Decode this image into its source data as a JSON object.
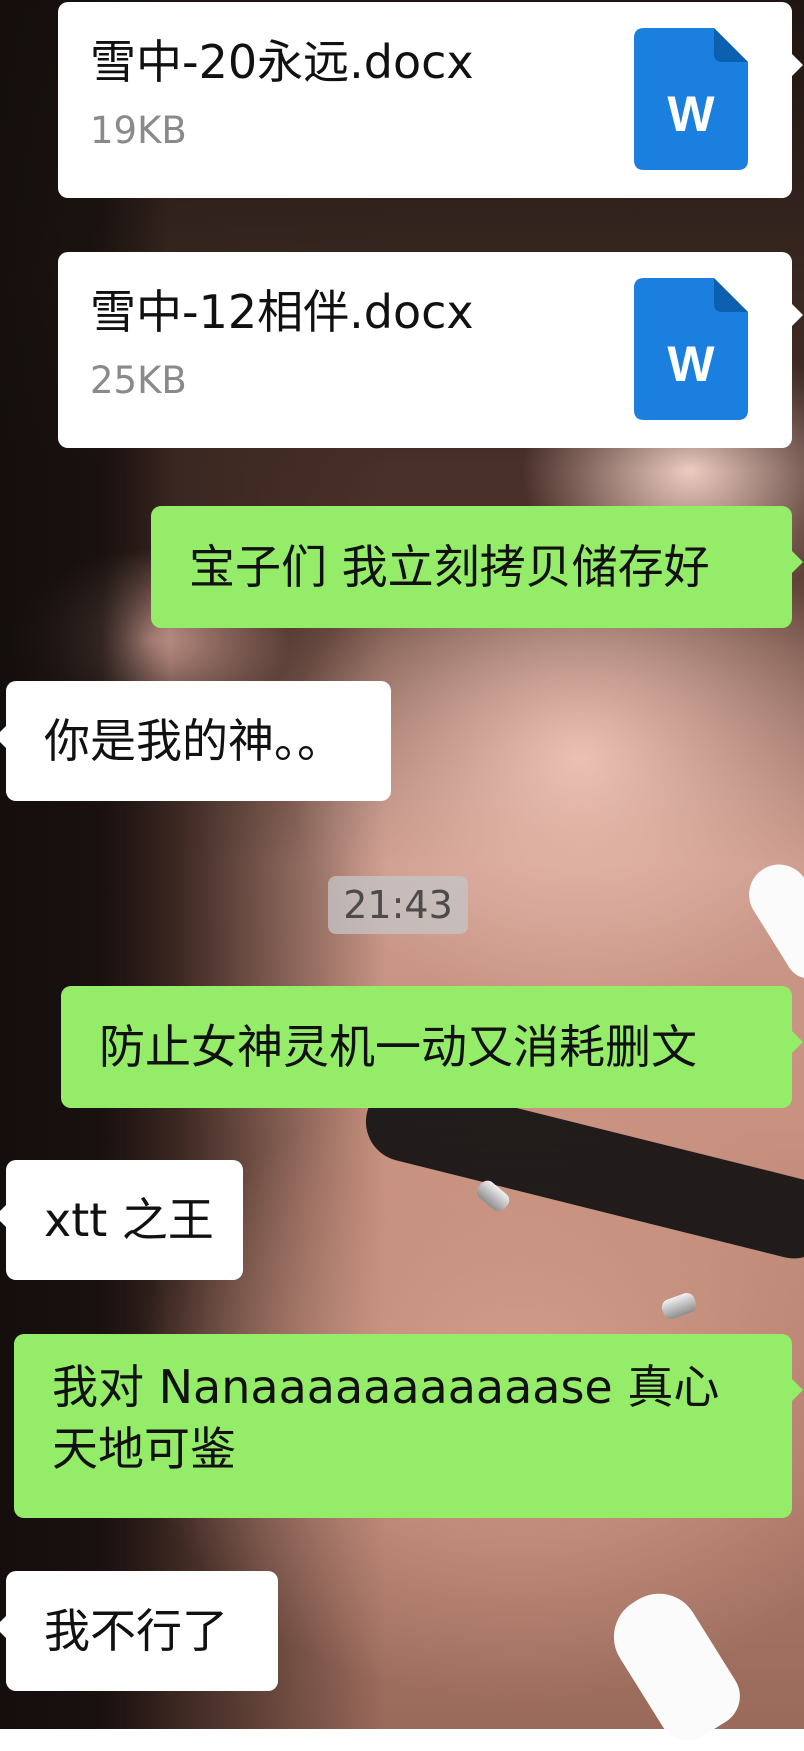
{
  "colors": {
    "sent_bubble": "#95ec69",
    "received_bubble": "#ffffff",
    "word_icon": "#1b7fe0",
    "timestamp_bg": "#c4c4c4"
  },
  "files": [
    {
      "name": "雪中-20永远.docx",
      "size": "19KB",
      "icon": "word-doc-icon",
      "icon_letter": "W"
    },
    {
      "name": "雪中-12相伴.docx",
      "size": "25KB",
      "icon": "word-doc-icon",
      "icon_letter": "W"
    }
  ],
  "messages": [
    {
      "side": "sent",
      "text": "宝子们 我立刻拷贝储存好"
    },
    {
      "side": "received",
      "text": "你是我的神。。"
    },
    {
      "side": "sent",
      "text": "防止女神灵机一动又消耗删文"
    },
    {
      "side": "received",
      "text": "xtt 之王"
    },
    {
      "side": "sent",
      "text": "我对 Nanaaaaaaaaaaase 真心天地可鉴"
    },
    {
      "side": "received",
      "text": "我不行了"
    }
  ],
  "timestamp": "21:43"
}
